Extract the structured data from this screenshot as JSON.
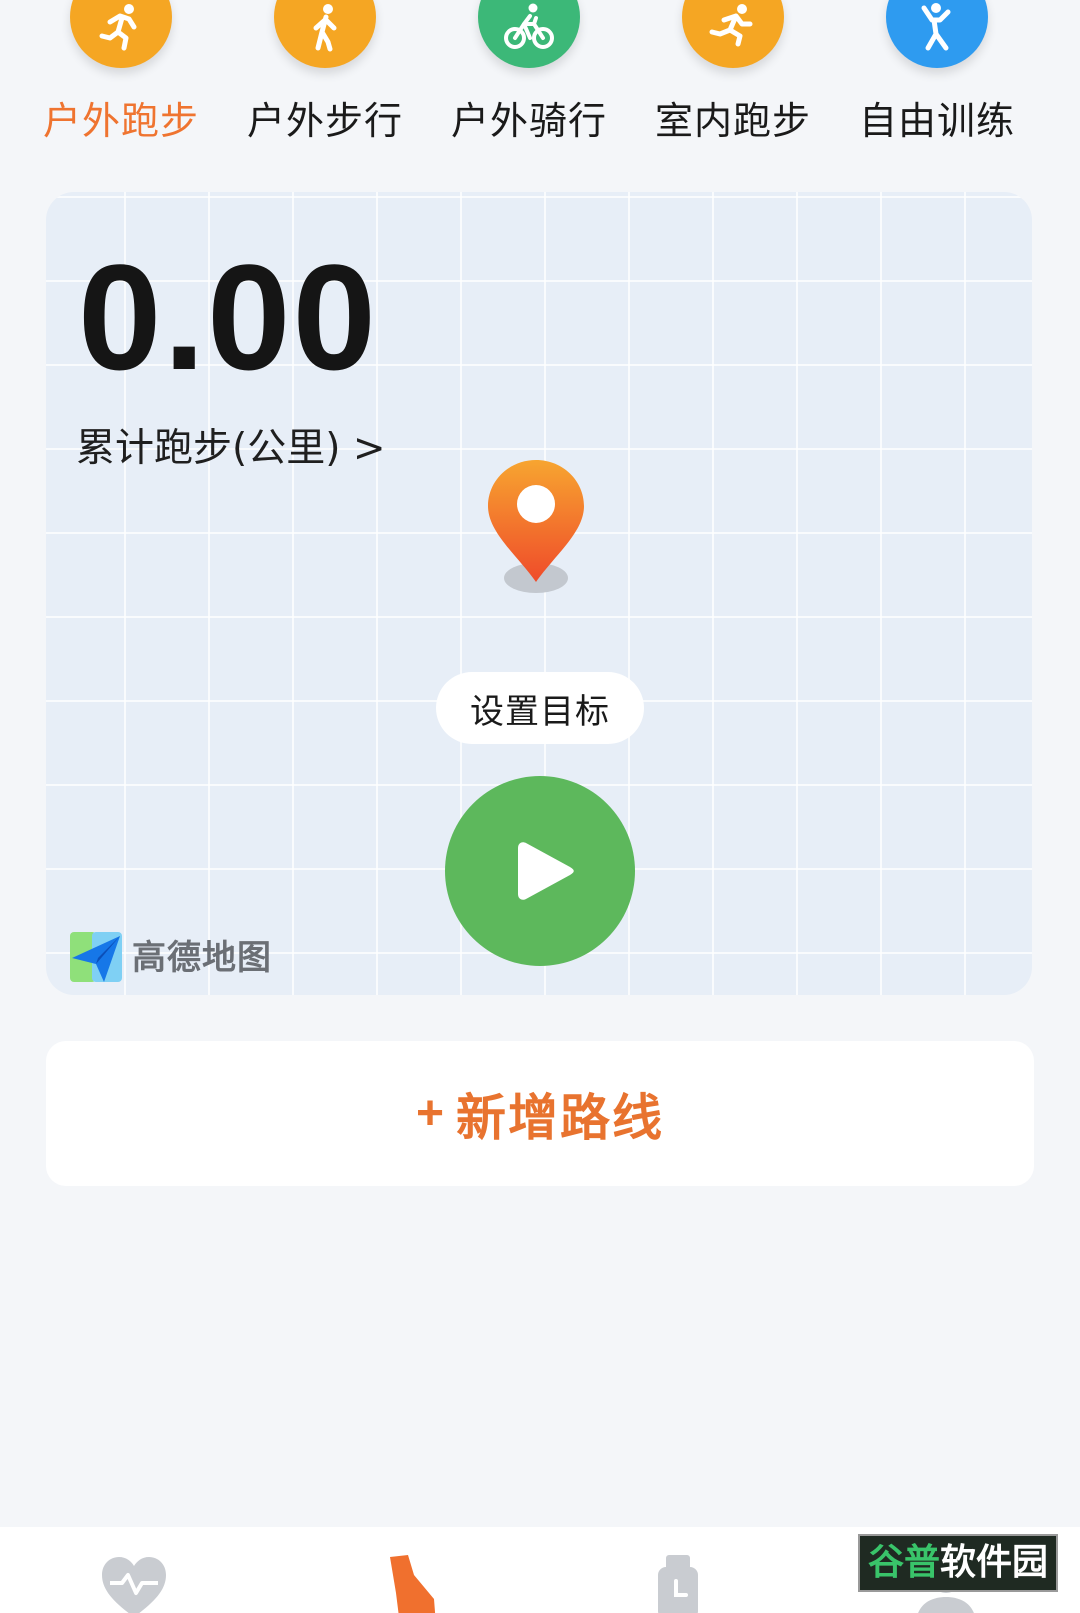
{
  "sport_tabs": [
    {
      "label": "户外跑步",
      "icon": "running-icon",
      "color": "#f5a623",
      "active": true
    },
    {
      "label": "户外步行",
      "icon": "walking-icon",
      "color": "#f5a623",
      "active": false
    },
    {
      "label": "户外骑行",
      "icon": "cycling-icon",
      "color": "#3cb878",
      "active": false
    },
    {
      "label": "室内跑步",
      "icon": "treadmill-running-icon",
      "color": "#f5a623",
      "active": false
    },
    {
      "label": "自由训练",
      "icon": "free-training-icon",
      "color": "#2e9bf0",
      "active": false
    }
  ],
  "map_card": {
    "distance_value": "0.00",
    "distance_label": "累计跑步(公里) >",
    "set_goal_label": "设置目标",
    "map_provider": "高德地图"
  },
  "add_route": {
    "plus": "+",
    "label": "新增路线"
  },
  "bottom_nav": {
    "items": [
      {
        "icon": "heart-icon",
        "active": false
      },
      {
        "icon": "sport-shoe-icon",
        "active": true
      },
      {
        "icon": "watch-icon",
        "active": false
      },
      {
        "icon": "profile-icon",
        "active": false
      }
    ]
  },
  "watermark": {
    "text_green": "谷普",
    "text_white": "软件园"
  },
  "colors": {
    "accent_orange": "#ef7430",
    "start_green": "#5db85c",
    "map_bg": "#e7eef7"
  }
}
